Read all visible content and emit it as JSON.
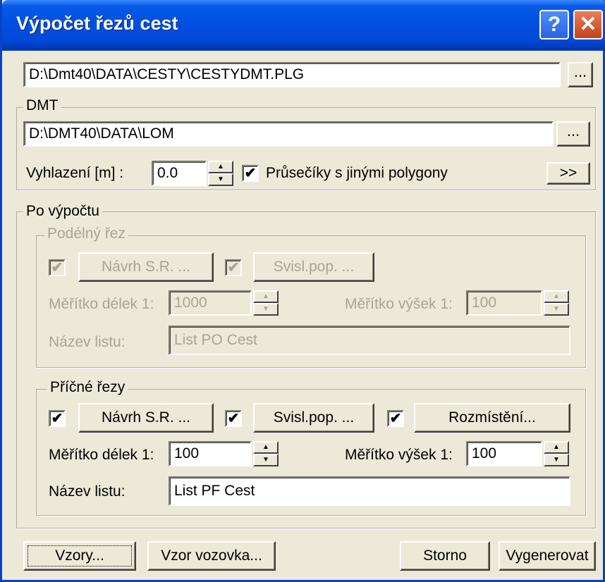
{
  "window": {
    "title": "Výpočet řezů cest",
    "help_label": "?",
    "close_label": "✕"
  },
  "file_path": {
    "value": "D:\\Dmt40\\DATA\\CESTY\\CESTYDMT.PLG",
    "browse_label": "..."
  },
  "dmt": {
    "label": "DMT",
    "path": "D:\\DMT40\\DATA\\LOM",
    "browse_label": "...",
    "smoothing_label": "Vyhlazení [m] :",
    "smoothing_value": "0.0",
    "intersections_checked": "✔",
    "intersections_label": "Průsečíky s jinými polygony",
    "more_label": ">>"
  },
  "after": {
    "label": "Po výpočtu",
    "longitudinal": {
      "label": "Podélný řez",
      "design_check": "✔",
      "design_label": "Návrh S.R. ...",
      "vertical_check": "✔",
      "vertical_label": "Svisl.pop. ...",
      "length_scale_label": "Měřítko délek 1:",
      "length_scale_value": "1000",
      "height_scale_label": "Měřítko výšek 1:",
      "height_scale_value": "100",
      "sheet_label": "Název listu:",
      "sheet_value": "List PO Cest"
    },
    "cross": {
      "label": "Příčné řezy",
      "design_check": "✔",
      "design_label": "Návrh S.R. ...",
      "vertical_check": "✔",
      "vertical_label": "Svisl.pop. ...",
      "placement_check": "✔",
      "placement_label": "Rozmístění...",
      "length_scale_label": "Měřítko délek 1:",
      "length_scale_value": "100",
      "height_scale_label": "Měřítko výšek 1:",
      "height_scale_value": "100",
      "sheet_label": "Název listu:",
      "sheet_value": "List PF Cest"
    }
  },
  "buttons": {
    "templates": "Vzory...",
    "road_template": "Vzor vozovka...",
    "cancel": "Storno",
    "generate": "Vygenerovat"
  },
  "spin": {
    "up": "▲",
    "down": "▼"
  },
  "colors": {
    "titlebar": "#0050E0",
    "dialog": "#ECE9D8",
    "disabled": "#A8A597"
  }
}
